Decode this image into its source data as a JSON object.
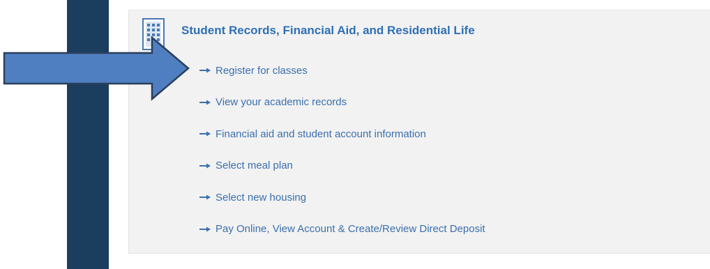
{
  "section": {
    "title": "Student Records, Financial Aid, and Residential Life",
    "icon": "building-icon"
  },
  "links": [
    {
      "label": "Register for classes",
      "icon": "right-arrow-icon"
    },
    {
      "label": "View your academic records",
      "icon": "right-arrow-icon"
    },
    {
      "label": "Financial aid and student account information",
      "icon": "right-arrow-icon"
    },
    {
      "label": "Select meal plan",
      "icon": "right-arrow-icon"
    },
    {
      "label": "Select new housing",
      "icon": "right-arrow-icon"
    },
    {
      "label": "Pay Online, View Account & Create/Review Direct Deposit",
      "icon": "right-arrow-icon"
    }
  ],
  "annotation": {
    "icon": "pointer-arrow-icon",
    "color": "#4f7fc0"
  },
  "colors": {
    "sidebar": "#1b3d5e",
    "panel_background": "#f2f2f2",
    "title": "#2e70b5",
    "link": "#3b6fae"
  }
}
